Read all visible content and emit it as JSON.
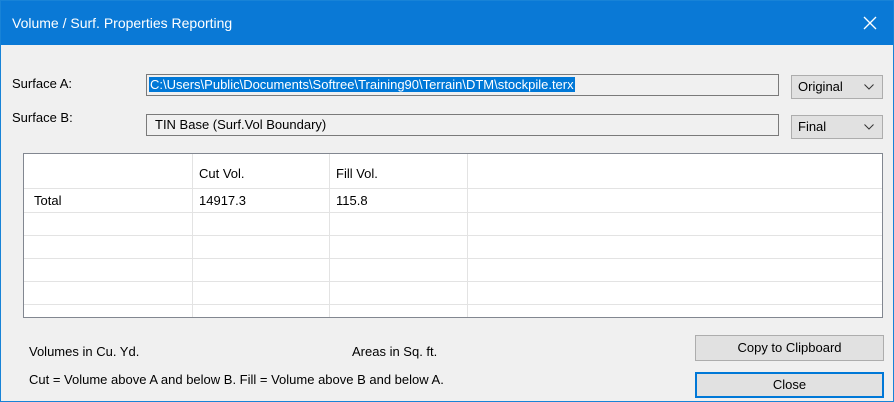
{
  "window": {
    "title": "Volume / Surf. Properties Reporting"
  },
  "surface_a": {
    "label": "Surface A:",
    "path": "C:\\Users\\Public\\Documents\\Softree\\Training90\\Terrain\\DTM\\stockpile.terx",
    "mode": "Original"
  },
  "surface_b": {
    "label": "Surface B:",
    "value": "TIN Base (Surf.Vol Boundary)",
    "mode": "Final"
  },
  "table": {
    "columns": [
      "",
      "Cut Vol.",
      "Fill Vol."
    ],
    "rows": [
      [
        "Total",
        "14917.3",
        "115.8"
      ]
    ]
  },
  "footer": {
    "volume_units": "Volumes in Cu. Yd.",
    "area_units": "Areas in Sq. ft.",
    "definition": "Cut = Volume above A and below B.  Fill = Volume above B and below A."
  },
  "buttons": {
    "copy": "Copy to Clipboard",
    "close": "Close"
  },
  "colors": {
    "titlebar": "#0a79d6",
    "selection": "#0078d7",
    "default_button_border": "#0078d7"
  }
}
